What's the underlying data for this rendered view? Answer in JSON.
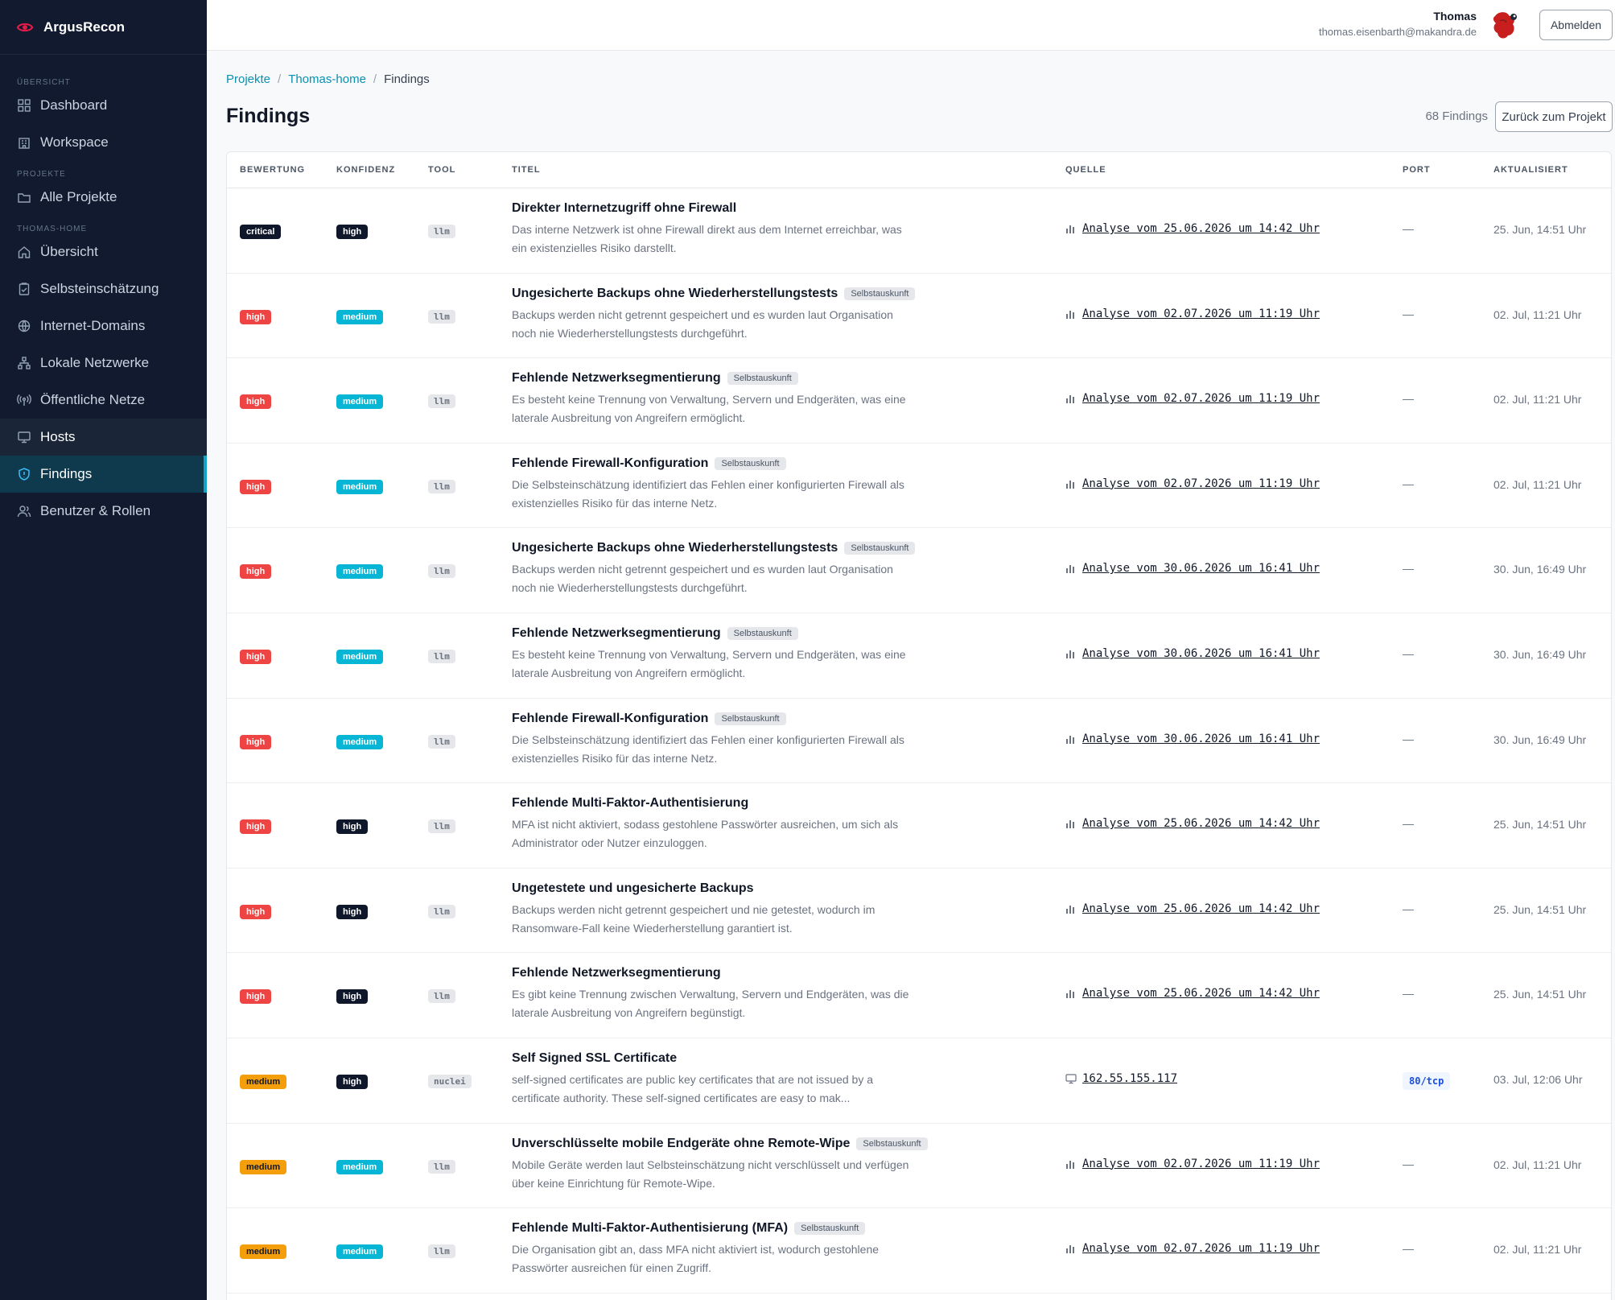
{
  "brand": {
    "name": "ArgusRecon"
  },
  "nav": {
    "section_overview": "ÜBERSICHT",
    "dashboard": "Dashboard",
    "workspace": "Workspace",
    "section_projects": "PROJEKTE",
    "all_projects": "Alle Projekte",
    "section_project": "THOMAS-HOME",
    "overview": "Übersicht",
    "self_assessment": "Selbsteinschätzung",
    "internet_domains": "Internet-Domains",
    "local_networks": "Lokale Netzwerke",
    "public_networks": "Öffentliche Netze",
    "hosts": "Hosts",
    "findings": "Findings",
    "users_roles": "Benutzer & Rollen"
  },
  "user": {
    "name": "Thomas",
    "email": "thomas.eisenbarth@makandra.de",
    "logout": "Abmelden"
  },
  "breadcrumb": {
    "projects": "Projekte",
    "project": "Thomas-home",
    "current": "Findings"
  },
  "page": {
    "title": "Findings",
    "count": "68 Findings",
    "back": "Zurück zum Projekt"
  },
  "columns": {
    "rating": "BEWERTUNG",
    "confidence": "KONFIDENZ",
    "tool": "TOOL",
    "title": "TITEL",
    "source": "QUELLE",
    "port": "PORT",
    "updated": "AKTUALISIERT"
  },
  "colors": {
    "accent": "#0891b2",
    "critical": "#0f172a",
    "high": "#ef4444",
    "medium": "#f59e0b",
    "conf_medium": "#06b6d4",
    "sidebar": "#111a2e"
  },
  "rows": [
    {
      "severity": "critical",
      "confidence": "high",
      "tool": "llm",
      "title": "Direkter Internetzugriff ohne Firewall",
      "tag": "",
      "desc1": "Das interne Netzwerk ist ohne Firewall direkt aus dem Internet erreichbar, was",
      "desc2": "ein existenzielles Risiko darstellt.",
      "source_icon": "chart-icon",
      "source": "Analyse vom 25.06.2026 um 14:42 Uhr",
      "port": "—",
      "updated": "25. Jun, 14:51 Uhr"
    },
    {
      "severity": "high",
      "confidence": "medium",
      "tool": "llm",
      "title": "Ungesicherte Backups ohne Wiederherstellungstests",
      "tag": "Selbstauskunft",
      "desc1": "Backups werden nicht getrennt gespeichert und es wurden laut Organisation",
      "desc2": "noch nie Wiederherstellungstests durchgeführt.",
      "source_icon": "chart-icon",
      "source": "Analyse vom 02.07.2026 um 11:19 Uhr",
      "port": "—",
      "updated": "02. Jul, 11:21 Uhr"
    },
    {
      "severity": "high",
      "confidence": "medium",
      "tool": "llm",
      "title": "Fehlende Netzwerksegmentierung",
      "tag": "Selbstauskunft",
      "desc1": "Es besteht keine Trennung von Verwaltung, Servern und Endgeräten, was eine",
      "desc2": "laterale Ausbreitung von Angreifern ermöglicht.",
      "source_icon": "chart-icon",
      "source": "Analyse vom 02.07.2026 um 11:19 Uhr",
      "port": "—",
      "updated": "02. Jul, 11:21 Uhr"
    },
    {
      "severity": "high",
      "confidence": "medium",
      "tool": "llm",
      "title": "Fehlende Firewall-Konfiguration",
      "tag": "Selbstauskunft",
      "desc1": "Die Selbsteinschätzung identifiziert das Fehlen einer konfigurierten Firewall als",
      "desc2": "existenzielles Risiko für das interne Netz.",
      "source_icon": "chart-icon",
      "source": "Analyse vom 02.07.2026 um 11:19 Uhr",
      "port": "—",
      "updated": "02. Jul, 11:21 Uhr"
    },
    {
      "severity": "high",
      "confidence": "medium",
      "tool": "llm",
      "title": "Ungesicherte Backups ohne Wiederherstellungstests",
      "tag": "Selbstauskunft",
      "desc1": "Backups werden nicht getrennt gespeichert und es wurden laut Organisation",
      "desc2": "noch nie Wiederherstellungstests durchgeführt.",
      "source_icon": "chart-icon",
      "source": "Analyse vom 30.06.2026 um 16:41 Uhr",
      "port": "—",
      "updated": "30. Jun, 16:49 Uhr"
    },
    {
      "severity": "high",
      "confidence": "medium",
      "tool": "llm",
      "title": "Fehlende Netzwerksegmentierung",
      "tag": "Selbstauskunft",
      "desc1": "Es besteht keine Trennung von Verwaltung, Servern und Endgeräten, was eine",
      "desc2": "laterale Ausbreitung von Angreifern ermöglicht.",
      "source_icon": "chart-icon",
      "source": "Analyse vom 30.06.2026 um 16:41 Uhr",
      "port": "—",
      "updated": "30. Jun, 16:49 Uhr"
    },
    {
      "severity": "high",
      "confidence": "medium",
      "tool": "llm",
      "title": "Fehlende Firewall-Konfiguration",
      "tag": "Selbstauskunft",
      "desc1": "Die Selbsteinschätzung identifiziert das Fehlen einer konfigurierten Firewall als",
      "desc2": "existenzielles Risiko für das interne Netz.",
      "source_icon": "chart-icon",
      "source": "Analyse vom 30.06.2026 um 16:41 Uhr",
      "port": "—",
      "updated": "30. Jun, 16:49 Uhr"
    },
    {
      "severity": "high",
      "confidence": "high",
      "tool": "llm",
      "title": "Fehlende Multi-Faktor-Authentisierung",
      "tag": "",
      "desc1": "MFA ist nicht aktiviert, sodass gestohlene Passwörter ausreichen, um sich als",
      "desc2": "Administrator oder Nutzer einzuloggen.",
      "source_icon": "chart-icon",
      "source": "Analyse vom 25.06.2026 um 14:42 Uhr",
      "port": "—",
      "updated": "25. Jun, 14:51 Uhr"
    },
    {
      "severity": "high",
      "confidence": "high",
      "tool": "llm",
      "title": "Ungetestete und ungesicherte Backups",
      "tag": "",
      "desc1": "Backups werden nicht getrennt gespeichert und nie getestet, wodurch im",
      "desc2": "Ransomware-Fall keine Wiederherstellung garantiert ist.",
      "source_icon": "chart-icon",
      "source": "Analyse vom 25.06.2026 um 14:42 Uhr",
      "port": "—",
      "updated": "25. Jun, 14:51 Uhr"
    },
    {
      "severity": "high",
      "confidence": "high",
      "tool": "llm",
      "title": "Fehlende Netzwerksegmentierung",
      "tag": "",
      "desc1": "Es gibt keine Trennung zwischen Verwaltung, Servern und Endgeräten, was die",
      "desc2": "laterale Ausbreitung von Angreifern begünstigt.",
      "source_icon": "chart-icon",
      "source": "Analyse vom 25.06.2026 um 14:42 Uhr",
      "port": "—",
      "updated": "25. Jun, 14:51 Uhr"
    },
    {
      "severity": "medium",
      "confidence": "high",
      "tool": "nuclei",
      "title": "Self Signed SSL Certificate",
      "tag": "",
      "desc1": "self-signed certificates are public key certificates that are not issued by a",
      "desc2": "certificate authority. These self-signed certificates are easy to mak...",
      "source_icon": "monitor-icon",
      "source": "162.55.155.117",
      "port": "80/tcp",
      "updated": "03. Jul, 12:06 Uhr"
    },
    {
      "severity": "medium",
      "confidence": "medium",
      "tool": "llm",
      "title": "Unverschlüsselte mobile Endgeräte ohne Remote-Wipe",
      "tag": "Selbstauskunft",
      "desc1": "Mobile Geräte werden laut Selbsteinschätzung nicht verschlüsselt und verfügen",
      "desc2": "über keine Einrichtung für Remote-Wipe.",
      "source_icon": "chart-icon",
      "source": "Analyse vom 02.07.2026 um 11:19 Uhr",
      "port": "—",
      "updated": "02. Jul, 11:21 Uhr"
    },
    {
      "severity": "medium",
      "confidence": "medium",
      "tool": "llm",
      "title": "Fehlende Multi-Faktor-Authentisierung (MFA)",
      "tag": "Selbstauskunft",
      "desc1": "Die Organisation gibt an, dass MFA nicht aktiviert ist, wodurch gestohlene",
      "desc2": "Passwörter ausreichen für einen Zugriff.",
      "source_icon": "chart-icon",
      "source": "Analyse vom 02.07.2026 um 11:19 Uhr",
      "port": "—",
      "updated": "02. Jul, 11:21 Uhr"
    }
  ]
}
